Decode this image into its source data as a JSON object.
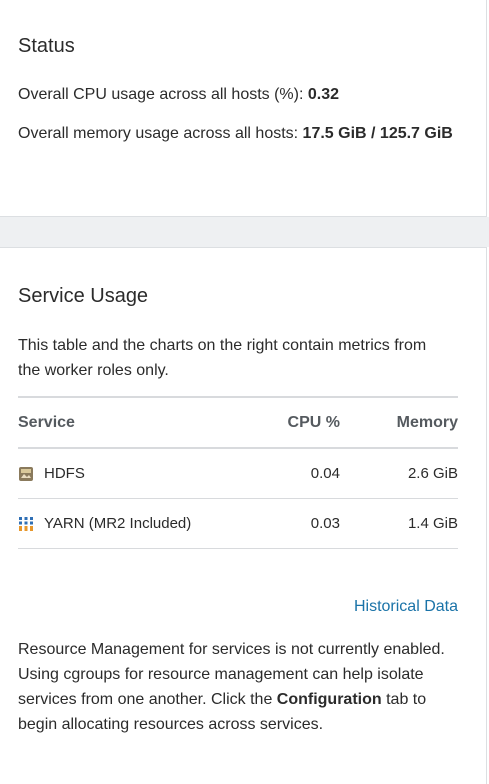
{
  "status": {
    "title": "Status",
    "cpu_label": "Overall CPU usage across all hosts (%): ",
    "cpu_value": "0.32",
    "memory_label": "Overall memory usage across all hosts: ",
    "memory_value": "17.5 GiB / 125.7 GiB"
  },
  "service_usage": {
    "title": "Service Usage",
    "description": "This table and the charts on the right contain metrics from the worker roles only.",
    "table": {
      "headers": [
        "Service",
        "CPU %",
        "Memory"
      ],
      "rows": [
        {
          "icon": "hdfs-icon",
          "service": "HDFS",
          "cpu": "0.04",
          "memory": "2.6 GiB"
        },
        {
          "icon": "yarn-icon",
          "service": "YARN (MR2 Included)",
          "cpu": "0.03",
          "memory": "1.4 GiB"
        }
      ]
    },
    "historical_link": "Historical Data",
    "notice_part1": "Resource Management for services is not currently enabled. Using cgroups for resource management can help isolate services from one another. Click the ",
    "notice_bold": "Configuration",
    "notice_part2": " tab to begin allocating resources across services.",
    "colors": {
      "link": "#1a73a8",
      "divider": "#d8dadd",
      "gap_background": "#eef0f2"
    }
  }
}
